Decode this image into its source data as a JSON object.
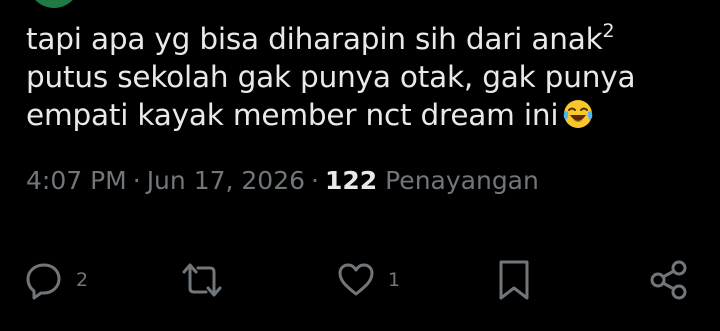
{
  "tweet": {
    "text_line1": "tapi apa yg bisa diharapin sih dari anak",
    "text_line1_sup": "2",
    "text_line2": "putus sekolah gak punya otak, gak punya",
    "text_line3": "empati kayak member nct dream ini",
    "emoji": "face-with-tears-of-joy-icon"
  },
  "meta": {
    "time": "4:07 PM",
    "separator": "·",
    "date": "Jun 17, 2026",
    "views_count": "122",
    "views_label": "Penayangan"
  },
  "actions": {
    "reply_count": "2",
    "retweet_count": "",
    "like_count": "1"
  },
  "colors": {
    "background": "#000000",
    "text": "#e7e9ea",
    "muted": "#71767b",
    "emoji_yellow": "#f9c62b"
  }
}
